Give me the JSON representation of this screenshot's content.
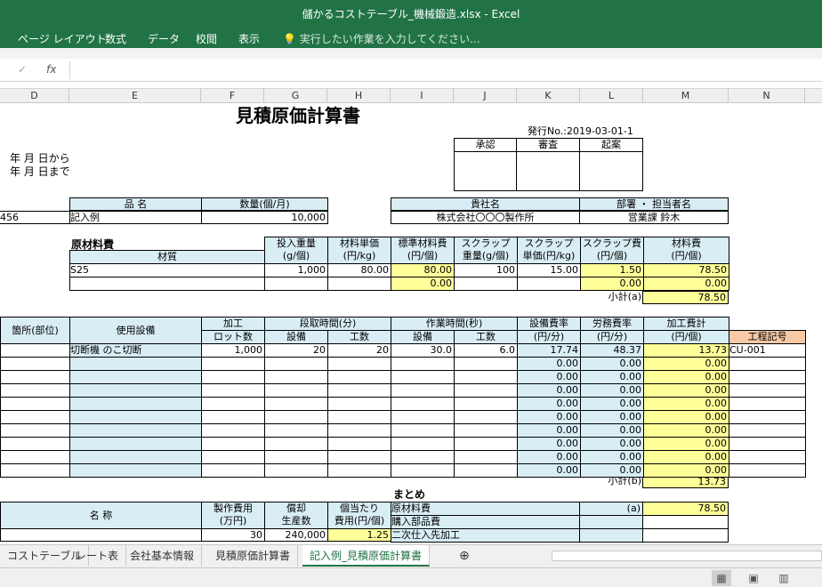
{
  "window": {
    "title": "儲かるコストテーブル_機械鍛造.xlsx - Excel"
  },
  "ribbon": {
    "tabs": [
      "ページ レイアウト",
      "数式",
      "データ",
      "校閲",
      "表示"
    ],
    "tell_me": "実行したい作業を入力してください..."
  },
  "formula_bar": {
    "cancel": "✓",
    "fx": "fx"
  },
  "columns": [
    "D",
    "E",
    "F",
    "G",
    "H",
    "I",
    "J",
    "K",
    "L",
    "M",
    "N"
  ],
  "sheet": {
    "title": "見積原価計算書",
    "issue_no": "発行No.:2019-03-01-1",
    "approval": [
      "承認",
      "審査",
      "起案"
    ],
    "date_from": "年 月 日から",
    "date_to": "年 月 日まで",
    "product_header": [
      "品 名",
      "数量(個/月)"
    ],
    "product_row": {
      "code": "456",
      "name": "記入例",
      "qty": "10,000"
    },
    "company_header": [
      "貴社名",
      "部署 ・ 担当者名"
    ],
    "company_row": [
      "株式会社〇〇〇製作所",
      "営業課 鈴木"
    ],
    "material": {
      "title": "原材料費",
      "col_material": "材質",
      "headers": [
        [
          "投入重量",
          "(g/個)"
        ],
        [
          "材料単価",
          "(円/kg)"
        ],
        [
          "標準材料費",
          "(円/個)"
        ],
        [
          "スクラップ",
          "重量(g/個)"
        ],
        [
          "スクラップ",
          "単価(円/kg)"
        ],
        [
          "スクラップ費",
          "(円/個)"
        ],
        [
          "材料費",
          "(円/個)"
        ]
      ],
      "rows": [
        [
          "S25",
          "1,000",
          "80.00",
          "80.00",
          "100",
          "15.00",
          "1.50",
          "78.50"
        ],
        [
          "",
          "",
          "",
          "0.00",
          "",
          "",
          "0.00",
          "0.00"
        ]
      ],
      "subtotal_label": "小計(a)",
      "subtotal": "78.50"
    },
    "process": {
      "h_place": "箇所(部位)",
      "h_equipment": "使用設備",
      "h_lot": [
        "加工",
        "ロット数"
      ],
      "h_setup": "段取時間(分)",
      "h_work": "作業時間(秒)",
      "h_sub": [
        "設備",
        "工数",
        "設備",
        "工数"
      ],
      "h_eq_rate": [
        "設備費率",
        "(円/分)"
      ],
      "h_labor_rate": [
        "労務費率",
        "(円/分)"
      ],
      "h_cost": [
        "加工費計",
        "(円/個)"
      ],
      "h_code": "工程記号",
      "rows": [
        [
          "切断機 のこ切断",
          "1,000",
          "20",
          "20",
          "30.0",
          "6.0",
          "17.74",
          "48.37",
          "13.73",
          "CU-001"
        ],
        [
          "",
          "",
          "",
          "",
          "",
          "",
          "0.00",
          "0.00",
          "0.00",
          ""
        ],
        [
          "",
          "",
          "",
          "",
          "",
          "",
          "0.00",
          "0.00",
          "0.00",
          ""
        ],
        [
          "",
          "",
          "",
          "",
          "",
          "",
          "0.00",
          "0.00",
          "0.00",
          ""
        ],
        [
          "",
          "",
          "",
          "",
          "",
          "",
          "0.00",
          "0.00",
          "0.00",
          ""
        ],
        [
          "",
          "",
          "",
          "",
          "",
          "",
          "0.00",
          "0.00",
          "0.00",
          ""
        ],
        [
          "",
          "",
          "",
          "",
          "",
          "",
          "0.00",
          "0.00",
          "0.00",
          ""
        ],
        [
          "",
          "",
          "",
          "",
          "",
          "",
          "0.00",
          "0.00",
          "0.00",
          ""
        ],
        [
          "",
          "",
          "",
          "",
          "",
          "",
          "0.00",
          "0.00",
          "0.00",
          ""
        ],
        [
          "",
          "",
          "",
          "",
          "",
          "",
          "0.00",
          "0.00",
          "0.00",
          ""
        ]
      ],
      "subtotal_label": "小計(b)",
      "subtotal": "13.73"
    },
    "summary": {
      "title": "まとめ",
      "h_name": "名 称",
      "h_cost": [
        "製作費用",
        "(万円)"
      ],
      "h_qty": [
        "償却",
        "生産数"
      ],
      "h_unit": [
        "個当たり",
        "費用(円/個)"
      ],
      "row": [
        "30",
        "240,000",
        "1.25"
      ],
      "items": [
        [
          "原材料費",
          "(a)",
          "78.50"
        ],
        [
          "購入部品費",
          "",
          ""
        ],
        [
          "二次仕入先加工",
          "",
          ""
        ]
      ]
    }
  },
  "sheet_tabs": [
    "コストテーブル",
    "レート表",
    "会社基本情報",
    "見積原価計算書",
    "記入例_見積原価計算書"
  ],
  "add_sheet": "⊕"
}
